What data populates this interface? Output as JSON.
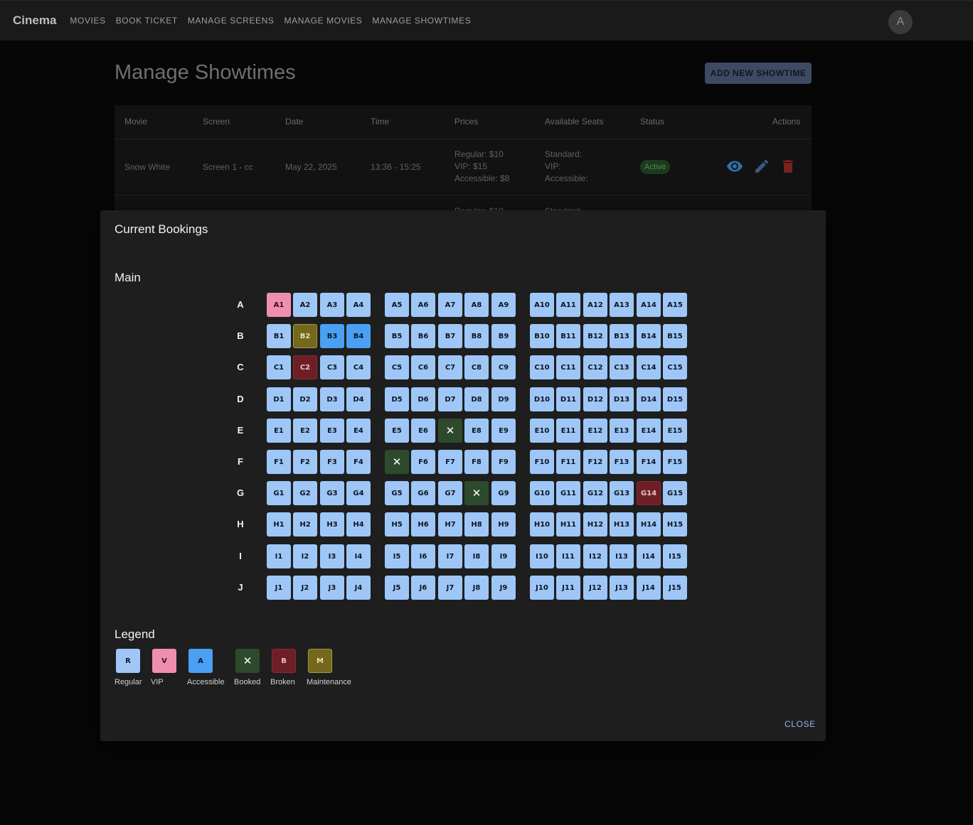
{
  "app": {
    "brand": "Cinema",
    "nav": [
      "MOVIES",
      "BOOK TICKET",
      "MANAGE SCREENS",
      "MANAGE MOVIES",
      "MANAGE SHOWTIMES"
    ],
    "avatar_letter": "A"
  },
  "page": {
    "title": "Manage Showtimes",
    "add_button": "ADD NEW SHOWTIME",
    "table": {
      "headers": [
        "Movie",
        "Screen",
        "Date",
        "Time",
        "Prices",
        "Available Seats",
        "Status",
        "Actions"
      ],
      "row": {
        "movie": "Snow White",
        "screen": "Screen 1 - cc",
        "date": "May 22, 2025",
        "time": "13:36 - 15:25",
        "price_regular": "Regular: $10",
        "price_vip": "VIP: $15",
        "price_accessible": "Accessible: $8",
        "seats_standard": "Standard:",
        "seats_vip": "VIP:",
        "seats_accessible": "Accessible:",
        "status": "Active"
      },
      "next_row_partial": {
        "price": "Regular: $10",
        "seats": "Standard:"
      }
    }
  },
  "dialog": {
    "title": "Current Bookings",
    "section": "Main",
    "rows": [
      "A",
      "B",
      "C",
      "D",
      "E",
      "F",
      "G",
      "H",
      "I",
      "J"
    ],
    "seats_per_row": 15,
    "special_seats": {
      "A1": "vip",
      "B2": "maintenance",
      "B3": "accessible",
      "B4": "accessible",
      "C2": "broken",
      "E7": "booked",
      "F5": "booked",
      "G8": "booked",
      "G14": "broken"
    },
    "legend_title": "Legend",
    "legend": [
      {
        "code": "R",
        "label": "Regular",
        "type": "regular"
      },
      {
        "code": "V",
        "label": "VIP",
        "type": "vip"
      },
      {
        "code": "A",
        "label": "Accessible",
        "type": "accessible"
      },
      {
        "code": "✕",
        "label": "Booked",
        "type": "booked"
      },
      {
        "code": "B",
        "label": "Broken",
        "type": "broken"
      },
      {
        "code": "M",
        "label": "Maintenance",
        "type": "maintenance"
      }
    ],
    "close_label": "CLOSE"
  },
  "colors": {
    "regular": "#9ec7f7",
    "vip": "#ef8fb0",
    "accessible": "#4aa0f2",
    "booked": "#2e4a2c",
    "broken": "#6e1f26",
    "maintenance": "#74671e"
  }
}
